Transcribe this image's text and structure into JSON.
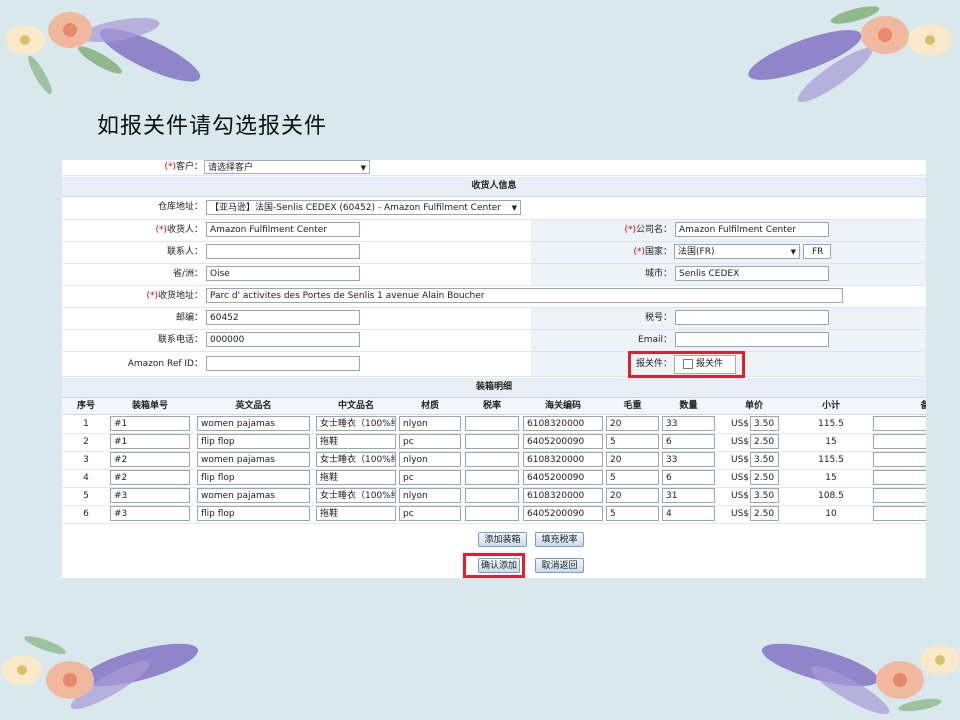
{
  "slide": {
    "title": "如报关件请勾选报关件"
  },
  "form": {
    "customer": {
      "label": "(*)客户：",
      "value": "请选择客户"
    },
    "receiver_section": "收货人信息",
    "warehouse": {
      "label": "仓库地址：",
      "value": "【亚马逊】法国-Senlis CEDEX (60452) - Amazon Fulfilment Center"
    },
    "consignee": {
      "label": "(*)收货人：",
      "value": "Amazon Fulfilment Center"
    },
    "company": {
      "label": "(*)公司名：",
      "value": "Amazon Fulfilment Center"
    },
    "contact": {
      "label": "联系人：",
      "value": ""
    },
    "country": {
      "label": "(*)国家：",
      "value": "法国(FR)",
      "code": "FR"
    },
    "province": {
      "label": "省/洲：",
      "value": "Oise"
    },
    "city": {
      "label": "城市：",
      "value": "Senlis CEDEX"
    },
    "address": {
      "label": "(*)收货地址：",
      "value": "Parc d' activites des Portes de Senlis 1 avenue Alain Boucher"
    },
    "postcode": {
      "label": "邮编：",
      "value": "60452"
    },
    "tax_no": {
      "label": "税号：",
      "value": ""
    },
    "phone": {
      "label": "联系电话：",
      "value": "000000"
    },
    "email": {
      "label": "Email：",
      "value": ""
    },
    "amazon_ref": {
      "label": "Amazon Ref ID：",
      "value": ""
    },
    "customs": {
      "label": "报关件：",
      "checkbox_label": "报关件"
    },
    "packing_section": "装箱明细"
  },
  "table": {
    "headers": [
      "序号",
      "装箱单号",
      "英文品名",
      "中文品名",
      "材质",
      "税率",
      "海关编码",
      "毛重",
      "数量",
      "单价",
      "小计",
      "备"
    ],
    "currency": "US$",
    "rows": [
      {
        "no": "1",
        "box": "#1",
        "en": "women pajamas",
        "cn": "女士睡衣（100%纯",
        "mat": "nlyon",
        "tax": "",
        "hs": "6108320000",
        "wt": "20",
        "qty": "33",
        "price": "3.50",
        "sub": "115.5"
      },
      {
        "no": "2",
        "box": "#1",
        "en": "flip flop",
        "cn": "拖鞋",
        "mat": "pc",
        "tax": "",
        "hs": "6405200090",
        "wt": "5",
        "qty": "6",
        "price": "2.50",
        "sub": "15"
      },
      {
        "no": "3",
        "box": "#2",
        "en": "women pajamas",
        "cn": "女士睡衣（100%纯",
        "mat": "nlyon",
        "tax": "",
        "hs": "6108320000",
        "wt": "20",
        "qty": "33",
        "price": "3.50",
        "sub": "115.5"
      },
      {
        "no": "4",
        "box": "#2",
        "en": "flip flop",
        "cn": "拖鞋",
        "mat": "pc",
        "tax": "",
        "hs": "6405200090",
        "wt": "5",
        "qty": "6",
        "price": "2.50",
        "sub": "15"
      },
      {
        "no": "5",
        "box": "#3",
        "en": "women pajamas",
        "cn": "女士睡衣（100%纯",
        "mat": "nlyon",
        "tax": "",
        "hs": "6108320000",
        "wt": "20",
        "qty": "31",
        "price": "3.50",
        "sub": "108.5"
      },
      {
        "no": "6",
        "box": "#3",
        "en": "flip flop",
        "cn": "拖鞋",
        "mat": "pc",
        "tax": "",
        "hs": "6405200090",
        "wt": "5",
        "qty": "4",
        "price": "2.50",
        "sub": "10"
      }
    ]
  },
  "buttons": {
    "add_box": "添加装箱",
    "fill_tax": "填充税率",
    "confirm_add": "确认添加",
    "cancel": "取消返回"
  },
  "colors": {
    "highlight": "#e2202c",
    "background": "#d9e8ec"
  }
}
